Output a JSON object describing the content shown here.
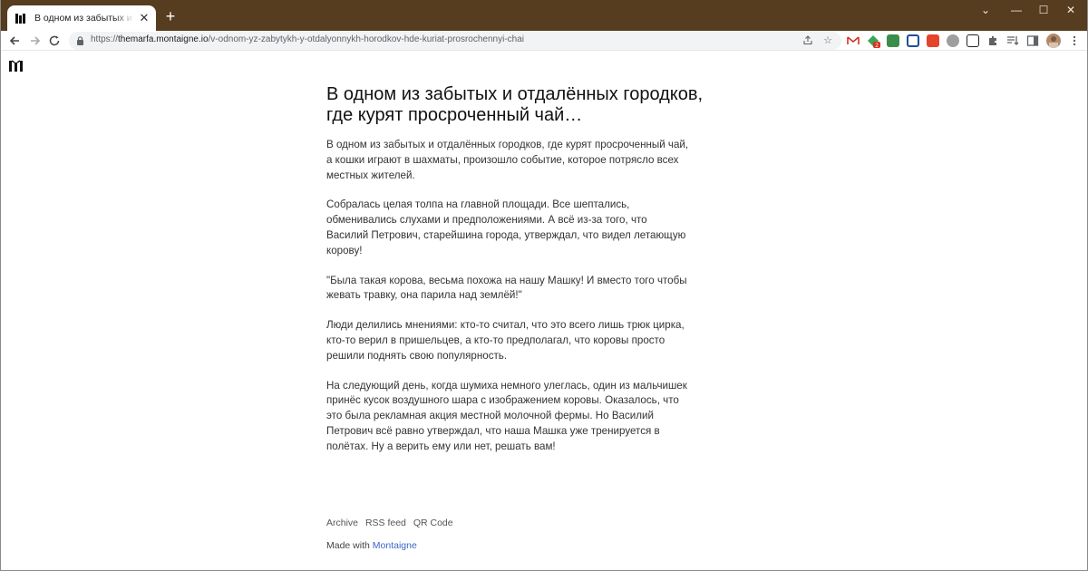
{
  "browser": {
    "tab": {
      "title": "В одном из забытых и отдалённых городков, где курят просроченный чай…",
      "close_glyph": "✕"
    },
    "new_tab_glyph": "+",
    "window_controls": {
      "menu": "⌄",
      "minimize": "—",
      "maximize": "☐",
      "close": "✕"
    },
    "address": {
      "scheme": "https://",
      "host": "themarfa.montaigne.io",
      "path": "/v-odnom-yz-zabytykh-y-otdalyonnykh-horodkov-hde-kuriat-prosrochennyi-chai"
    },
    "icons": [
      "back-icon",
      "forward-icon",
      "reload-icon",
      "lock-icon",
      "share-icon",
      "bookmark-star-icon",
      "extensions-icon",
      "reading-list-icon",
      "side-panel-icon",
      "profile-avatar",
      "menu-icon"
    ],
    "extension_badge": "2",
    "colors": {
      "titlebar": "#563d1f",
      "link": "#3b66c4"
    }
  },
  "article": {
    "title": "В одном из забытых и отдалённых городков, где курят просроченный чай…",
    "paragraphs": [
      "В одном из забытых и отдалённых городков, где курят просроченный чай, а кошки играют в шахматы, произошло событие, которое потрясло всех местных жителей.",
      "Собралась целая толпа на главной площади. Все шептались, обменивались слухами и предположениями. А всё из-за того, что Василий Петрович, старейшина города, утверждал, что видел летающую корову!",
      "\"Была такая корова, весьма похожа на нашу Машку! И вместо того чтобы жевать травку, она парила над землёй!\"",
      "Люди делились мнениями: кто-то считал, что это всего лишь трюк цирка, кто-то верил в пришельцев, а кто-то предполагал, что коровы просто решили поднять свою популярность.",
      "На следующий день, когда шумиха немного улеглась, один из мальчишек принёс кусок воздушного шара с изображением коровы. Оказалось, что это была рекламная акция местной молочной фермы. Но Василий Петрович всё равно утверждал, что наша Машка уже тренируется в полётах. Ну а верить ему или нет, решать вам!"
    ]
  },
  "footer": {
    "links": [
      "Archive",
      "RSS feed",
      "QR Code"
    ],
    "made_with_prefix": "Made with",
    "made_with_link": "Montaigne"
  }
}
